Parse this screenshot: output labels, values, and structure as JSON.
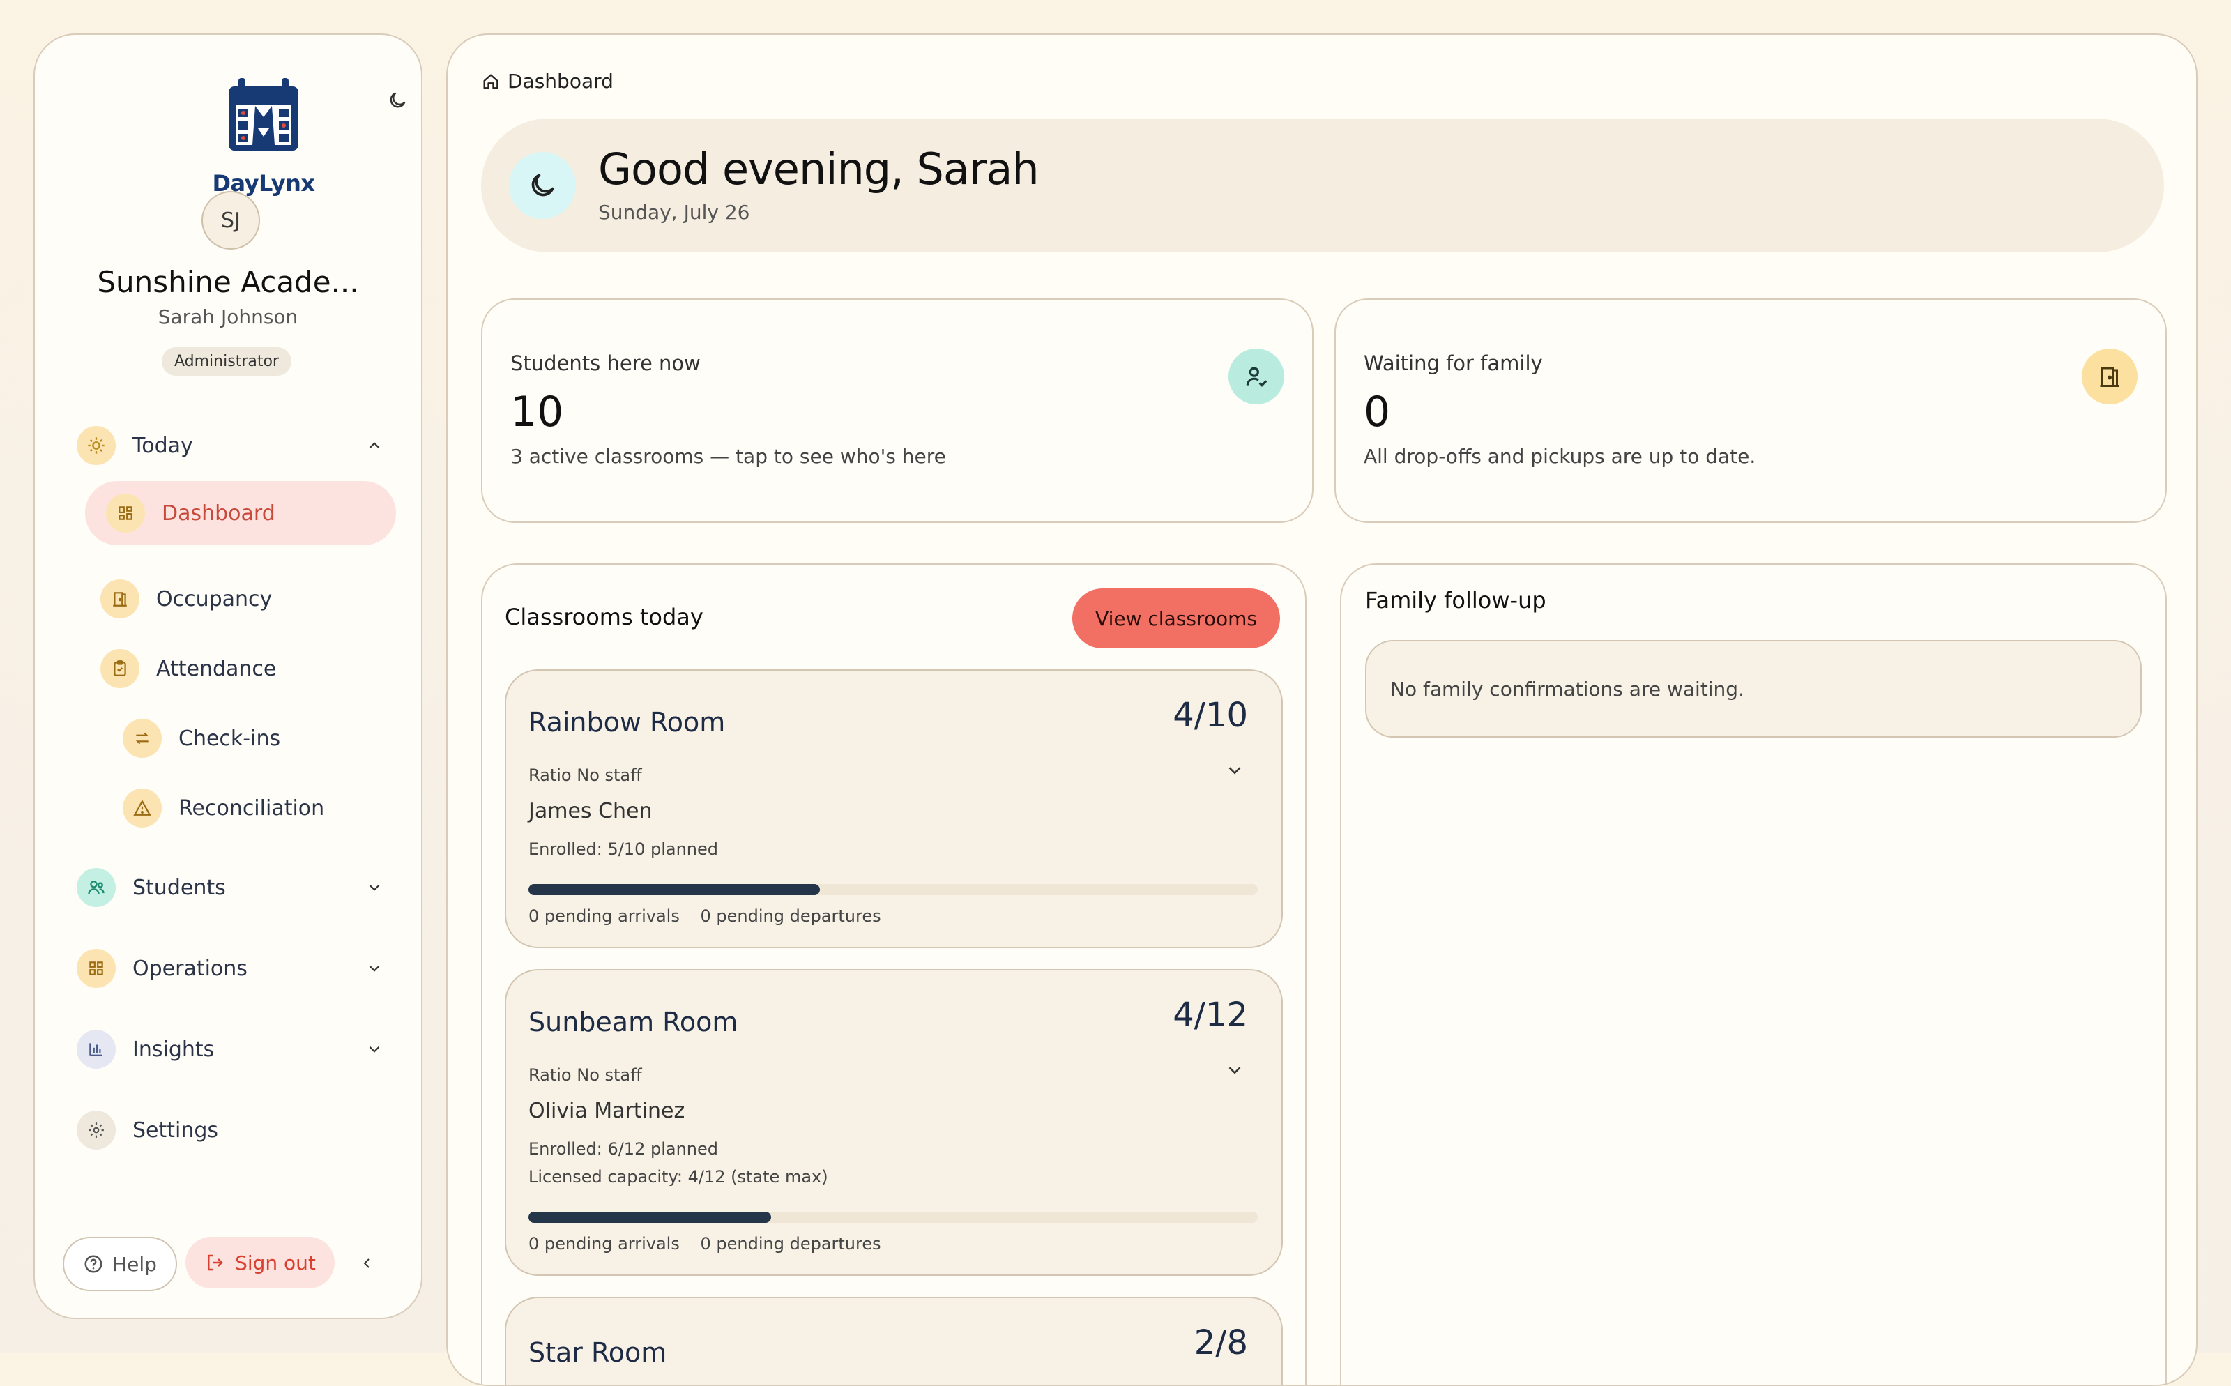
{
  "sidebar": {
    "logo_text": "DayLynx",
    "avatar_initials": "SJ",
    "org_name": "Sunshine Acade...",
    "user_name": "Sarah Johnson",
    "role": "Administrator",
    "nav": {
      "today": "Today",
      "dashboard": "Dashboard",
      "occupancy": "Occupancy",
      "attendance": "Attendance",
      "checkins": "Check-ins",
      "reconciliation": "Reconciliation",
      "students": "Students",
      "operations": "Operations",
      "insights": "Insights",
      "settings": "Settings"
    },
    "help": "Help",
    "signout": "Sign out"
  },
  "main": {
    "breadcrumb": "Dashboard",
    "greeting": "Good evening, Sarah",
    "date": "Sunday, July 26",
    "stats": [
      {
        "label": "Students here now",
        "value": "10",
        "sub": "3 active classrooms — tap to see who's here"
      },
      {
        "label": "Waiting for family",
        "value": "0",
        "sub": "All drop-offs and pickups are up to date."
      }
    ],
    "classrooms": {
      "title": "Classrooms today",
      "button": "View classrooms",
      "rooms": [
        {
          "name": "Rainbow Room",
          "count": "4/10",
          "ratio": "Ratio No staff",
          "teacher": "James Chen",
          "enrolled": "Enrolled: 5/10 planned",
          "capacity": "",
          "progress": 0.4,
          "arrivals": "0 pending arrivals",
          "departures": "0 pending departures"
        },
        {
          "name": "Sunbeam Room",
          "count": "4/12",
          "ratio": "Ratio No staff",
          "teacher": "Olivia Martinez",
          "enrolled": "Enrolled: 6/12 planned",
          "capacity": "Licensed capacity: 4/12 (state max)",
          "progress": 0.333,
          "arrivals": "0 pending arrivals",
          "departures": "0 pending departures"
        },
        {
          "name": "Star Room",
          "count": "2/8"
        }
      ]
    },
    "followup": {
      "title": "Family follow-up",
      "empty": "No family confirmations are waiting."
    }
  },
  "colors": {
    "accent": "#f26f63",
    "active_nav_bg": "#fde3df",
    "navy": "#173a75"
  }
}
